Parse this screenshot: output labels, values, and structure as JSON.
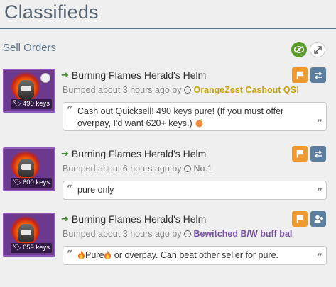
{
  "page": {
    "title": "Classifieds",
    "section": "Sell Orders"
  },
  "colors": {
    "eye_button": "#5b9c2d",
    "flag_button": "#ef9a2f",
    "action_button": "#5c7fa0",
    "thumb_bg": "#6b3a8e"
  },
  "listings": [
    {
      "name": "Burning Flames Herald's Helm",
      "bumped": "Bumped about 3 hours ago by",
      "user": "OrangeZest Cashout QS!",
      "price": "490 keys",
      "message": "Cash out Quicksell! 490 keys pure! (If you must offer overpay, I'd want 620+ keys.)",
      "action_icon": "exchange-icon"
    },
    {
      "name": "Burning Flames Herald's Helm",
      "bumped": "Bumped about 6 hours ago by",
      "user": "No.1",
      "price": "600 keys",
      "message": "pure only",
      "action_icon": "exchange-icon"
    },
    {
      "name": "Burning Flames Herald's Helm",
      "bumped": "Bumped about 3 hours ago by",
      "user": "Bewitched B/W buff bal",
      "price": "659 keys",
      "message_part1": "Pure",
      "message_part2": " or overpay. Can beat other seller for pure.",
      "action_icon": "add-friend-icon"
    }
  ]
}
